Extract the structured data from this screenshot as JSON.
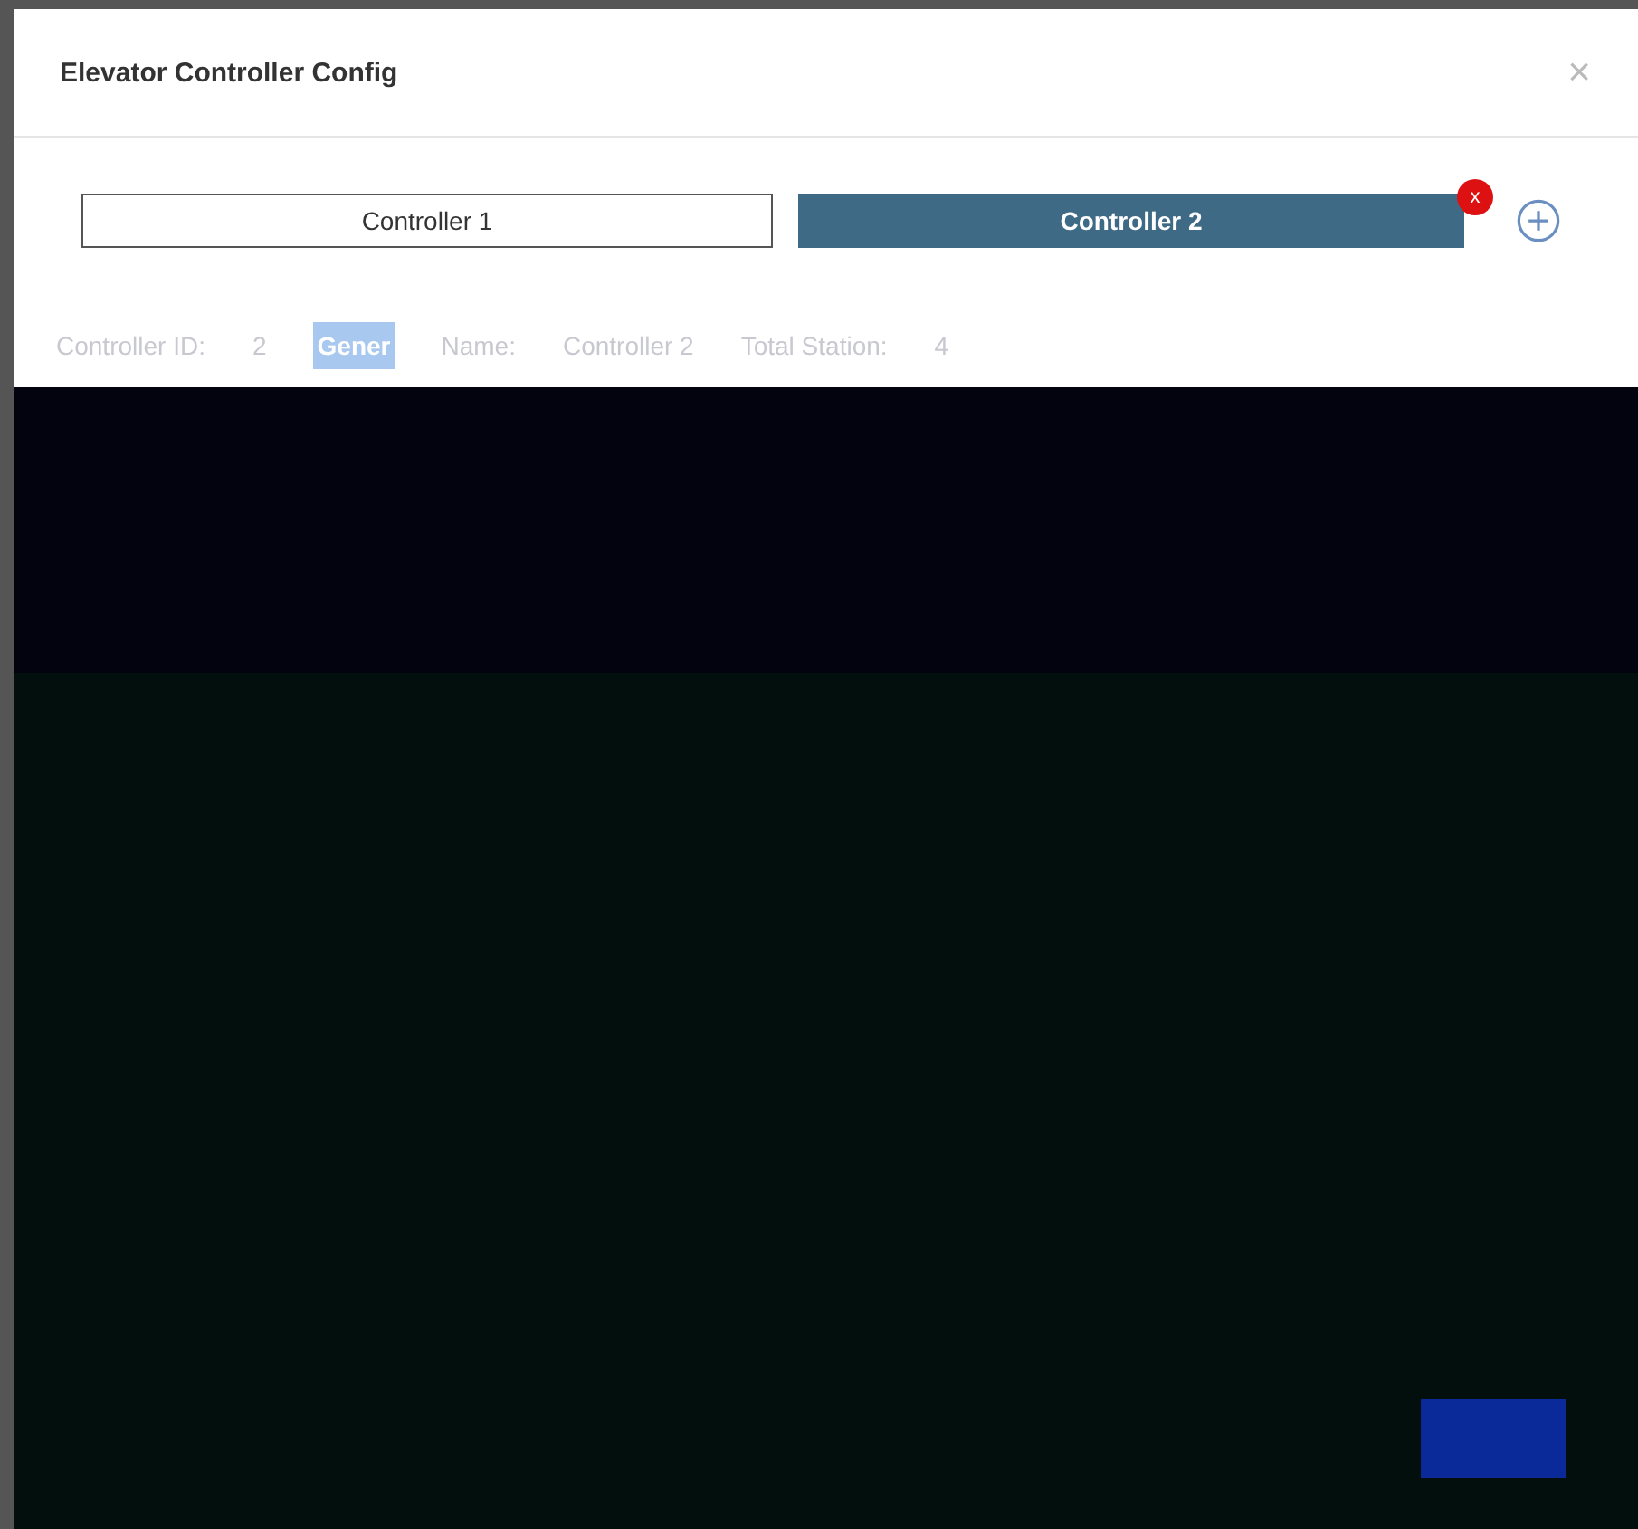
{
  "dialog": {
    "title": "Elevator Controller Config",
    "close": "×"
  },
  "tabs": [
    {
      "label": "Controller 1",
      "selected": false
    },
    {
      "label": "Controller 2",
      "selected": true
    }
  ],
  "remove_badge": "x",
  "info": [
    {
      "kind": "field",
      "label": "Controller ID:",
      "value": "2"
    },
    {
      "kind": "tag",
      "label": "Gener"
    },
    {
      "kind": "field",
      "label": "Name:",
      "value": "Controller 2"
    },
    {
      "kind": "field",
      "label": "Total Station:",
      "value": "4"
    }
  ]
}
